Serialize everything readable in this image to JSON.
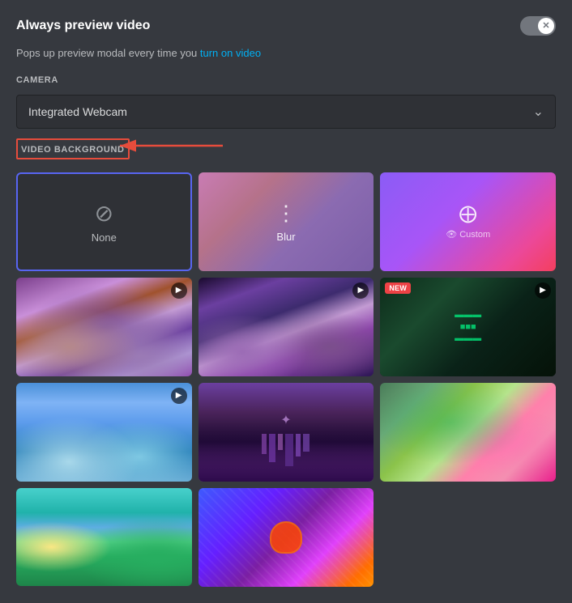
{
  "header": {
    "title": "Always preview video",
    "subtitle": "Pops up preview modal every time you turn on video",
    "subtitle_highlight": "turn on video"
  },
  "toggle": {
    "active": false
  },
  "camera": {
    "label": "CAMERA",
    "selected": "Integrated Webcam",
    "options": [
      "Integrated Webcam"
    ]
  },
  "video_background": {
    "label": "VIDEO BACKGROUND",
    "options": [
      {
        "id": "none",
        "label": "None",
        "type": "none",
        "selected": true
      },
      {
        "id": "blur",
        "label": "Blur",
        "type": "blur",
        "selected": false
      },
      {
        "id": "custom",
        "label": "Custom",
        "type": "custom",
        "selected": false
      }
    ],
    "thumbnails": [
      {
        "id": "thumb1",
        "row": 1,
        "col": 1,
        "type": "landscape1",
        "has_play": true,
        "is_new": false
      },
      {
        "id": "thumb2",
        "row": 1,
        "col": 2,
        "type": "landscape2",
        "has_play": true,
        "is_new": false
      },
      {
        "id": "thumb3",
        "row": 1,
        "col": 3,
        "type": "cyber",
        "has_play": true,
        "is_new": true
      },
      {
        "id": "thumb4",
        "row": 2,
        "col": 1,
        "type": "ice",
        "has_play": true,
        "is_new": false
      },
      {
        "id": "thumb5",
        "row": 2,
        "col": 2,
        "type": "purple_city",
        "has_play": false,
        "is_new": false
      },
      {
        "id": "thumb6",
        "row": 2,
        "col": 3,
        "type": "aerial",
        "has_play": false,
        "is_new": false
      },
      {
        "id": "thumb7",
        "row": 3,
        "col": 1,
        "type": "tropical",
        "has_play": false,
        "is_new": false
      },
      {
        "id": "thumb8",
        "row": 3,
        "col": 2,
        "type": "cartoon",
        "has_play": false,
        "is_new": false
      }
    ]
  },
  "icons": {
    "none": "⊘",
    "blur": "▦",
    "custom": "⊕",
    "play": "▶",
    "chevron_down": "∨",
    "close": "✕"
  },
  "colors": {
    "accent_blue": "#5865f2",
    "red": "#ed4245",
    "toggle_off": "#72767d",
    "bg_dark": "#2f3136",
    "bg_main": "#36393f"
  },
  "new_badge_label": "NEW"
}
